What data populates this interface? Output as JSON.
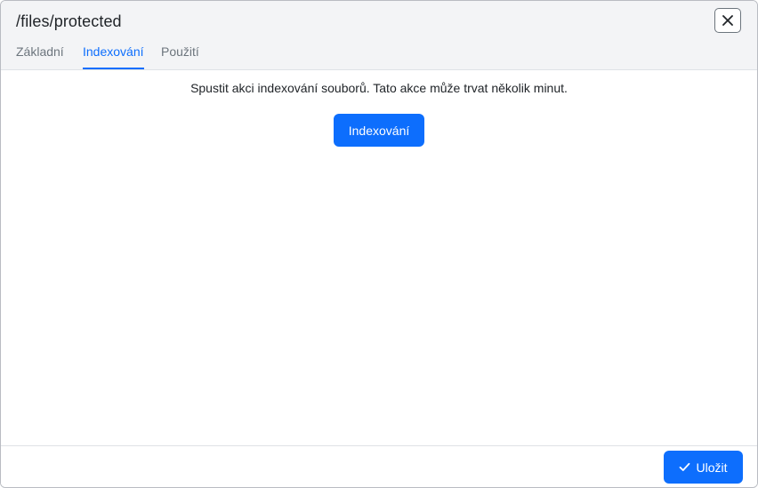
{
  "dialog": {
    "title": "/files/protected",
    "close_icon": "close-icon"
  },
  "tabs": [
    {
      "label": "Základní",
      "active": false
    },
    {
      "label": "Indexování",
      "active": true
    },
    {
      "label": "Použití",
      "active": false
    }
  ],
  "content": {
    "message": "Spustit akci indexování souborů. Tato akce může trvat několik minut.",
    "index_button_label": "Indexování"
  },
  "footer": {
    "save_label": "Uložit",
    "save_icon": "check-icon"
  },
  "colors": {
    "accent": "#0d6efd",
    "header_bg": "#f3f4f6",
    "muted_text": "#6c757d"
  }
}
